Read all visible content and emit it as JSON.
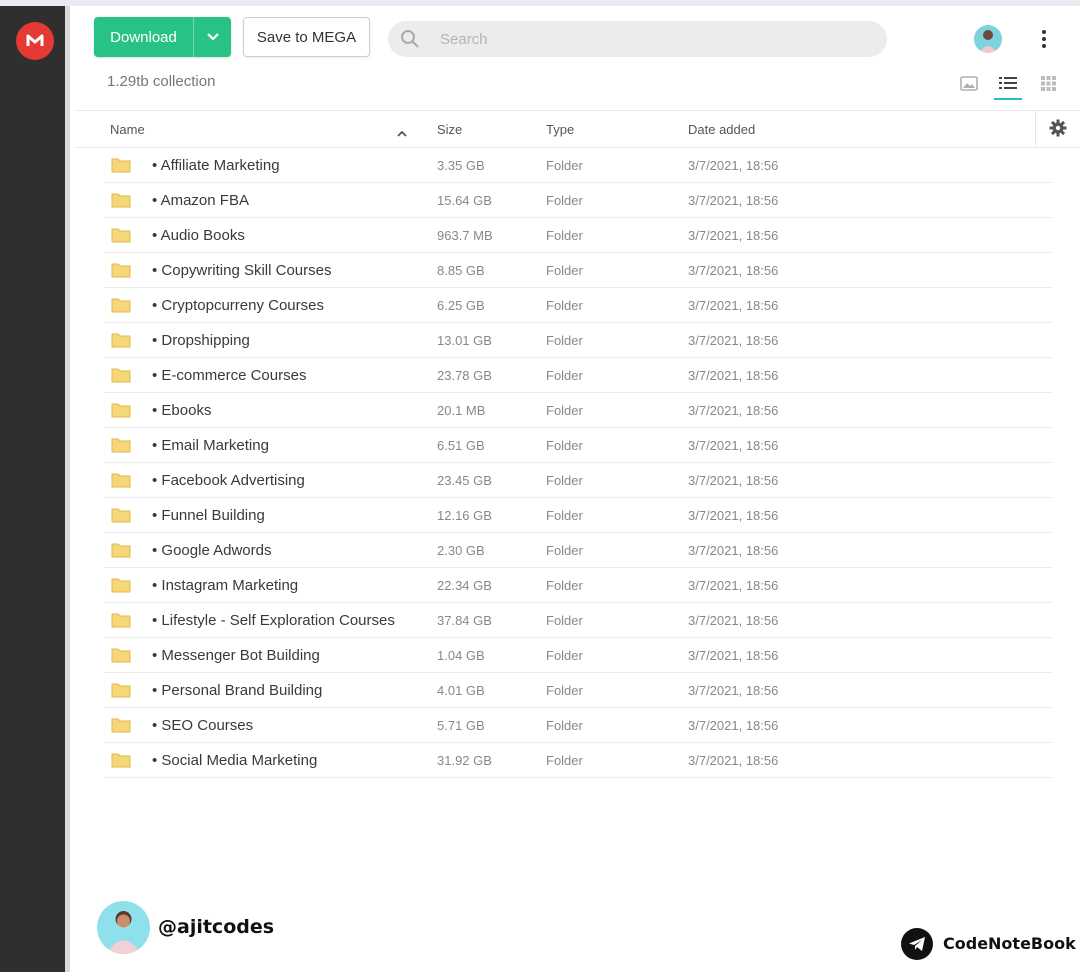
{
  "toolbar": {
    "download_label": "Download",
    "save_label": "Save to MEGA",
    "search_placeholder": "Search"
  },
  "folder_info": {
    "collection_label": "1.29tb collection"
  },
  "table": {
    "columns": {
      "name": "Name",
      "size": "Size",
      "type": "Type",
      "date": "Date added"
    },
    "rows": [
      {
        "name": "• Affiliate Marketing",
        "size": "3.35 GB",
        "type": "Folder",
        "date": "3/7/2021, 18:56"
      },
      {
        "name": "• Amazon FBA",
        "size": "15.64 GB",
        "type": "Folder",
        "date": "3/7/2021, 18:56"
      },
      {
        "name": "• Audio Books",
        "size": "963.7 MB",
        "type": "Folder",
        "date": "3/7/2021, 18:56"
      },
      {
        "name": "• Copywriting Skill Courses",
        "size": "8.85 GB",
        "type": "Folder",
        "date": "3/7/2021, 18:56"
      },
      {
        "name": "• Cryptopcurreny Courses",
        "size": "6.25 GB",
        "type": "Folder",
        "date": "3/7/2021, 18:56"
      },
      {
        "name": "• Dropshipping",
        "size": "13.01 GB",
        "type": "Folder",
        "date": "3/7/2021, 18:56"
      },
      {
        "name": "• E-commerce Courses",
        "size": "23.78 GB",
        "type": "Folder",
        "date": "3/7/2021, 18:56"
      },
      {
        "name": "• Ebooks",
        "size": "20.1 MB",
        "type": "Folder",
        "date": "3/7/2021, 18:56"
      },
      {
        "name": "• Email Marketing",
        "size": "6.51 GB",
        "type": "Folder",
        "date": "3/7/2021, 18:56"
      },
      {
        "name": "• Facebook Advertising",
        "size": "23.45 GB",
        "type": "Folder",
        "date": "3/7/2021, 18:56"
      },
      {
        "name": "• Funnel Building",
        "size": "12.16 GB",
        "type": "Folder",
        "date": "3/7/2021, 18:56"
      },
      {
        "name": "• Google Adwords",
        "size": "2.30 GB",
        "type": "Folder",
        "date": "3/7/2021, 18:56"
      },
      {
        "name": "• Instagram Marketing",
        "size": "22.34 GB",
        "type": "Folder",
        "date": "3/7/2021, 18:56"
      },
      {
        "name": "• Lifestyle - Self Exploration Courses",
        "size": "37.84 GB",
        "type": "Folder",
        "date": "3/7/2021, 18:56"
      },
      {
        "name": "• Messenger Bot Building",
        "size": "1.04 GB",
        "type": "Folder",
        "date": "3/7/2021, 18:56"
      },
      {
        "name": "• Personal Brand Building",
        "size": "4.01 GB",
        "type": "Folder",
        "date": "3/7/2021, 18:56"
      },
      {
        "name": "• SEO Courses",
        "size": "5.71 GB",
        "type": "Folder",
        "date": "3/7/2021, 18:56"
      },
      {
        "name": "• Social Media Marketing",
        "size": "31.92 GB",
        "type": "Folder",
        "date": "3/7/2021, 18:56"
      }
    ]
  },
  "overlay": {
    "handle": "@ajitcodes",
    "brand": "CodeNoteBook"
  },
  "icons": {
    "logo": "mega-logo-icon",
    "caret": "chevron-down-icon",
    "search": "search-icon",
    "menu": "kebab-menu-icon",
    "thumbs_view": "image-icon",
    "list_view": "list-icon",
    "grid_view": "grid-icon",
    "sort": "sort-up-icon",
    "settings": "gear-icon",
    "folder": "folder-icon",
    "telegram": "telegram-icon"
  },
  "colors": {
    "sidebar": "#2f2f2f",
    "logo": "#e53935",
    "download_button": "#29c285",
    "active_view": "#2bb8c9",
    "folder": "#f5d77a"
  }
}
